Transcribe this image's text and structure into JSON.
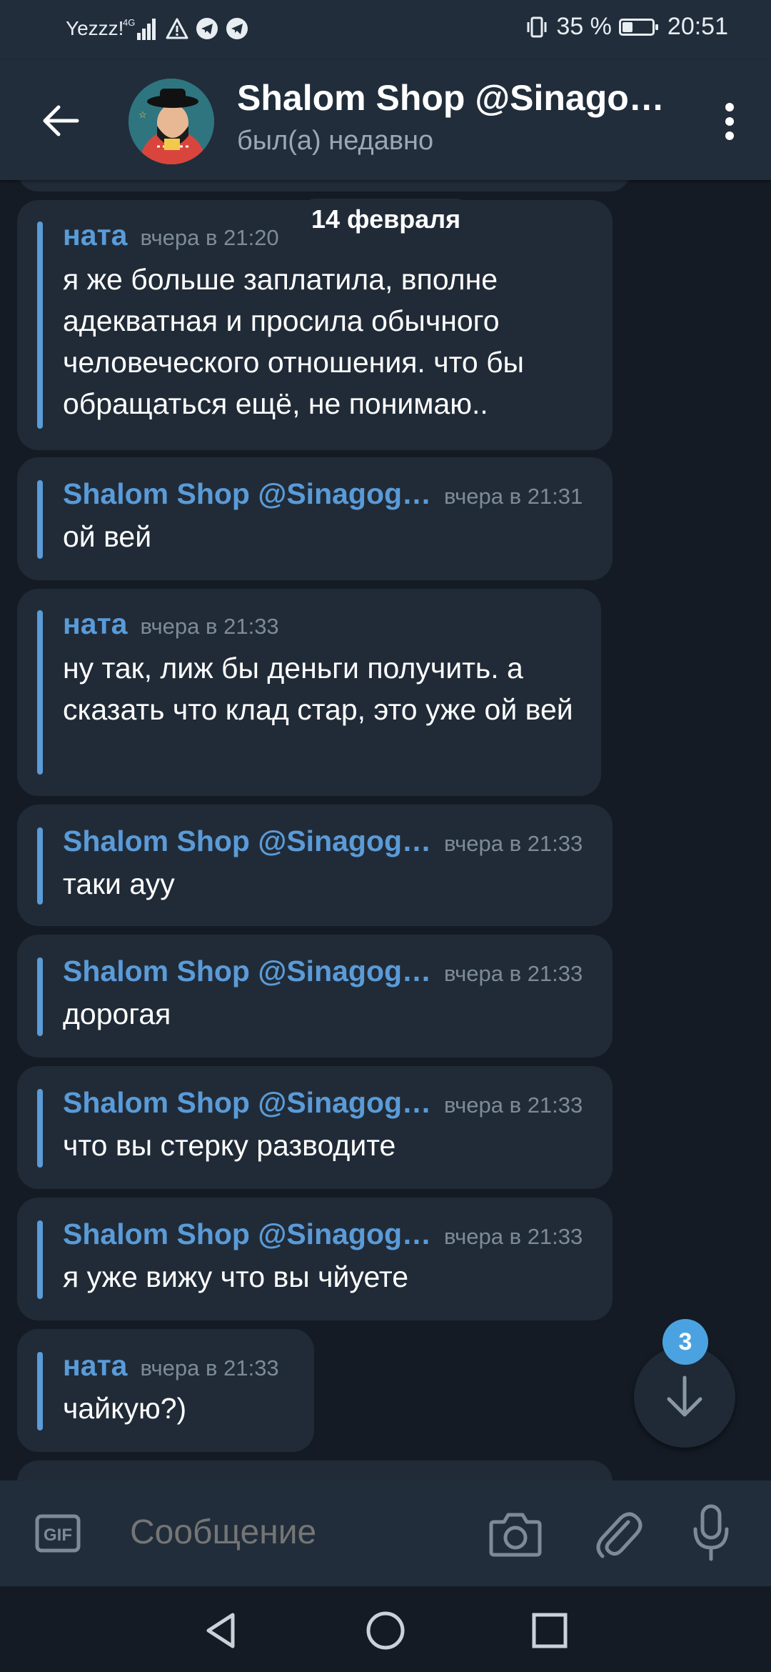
{
  "status_bar": {
    "carrier": "Yezzz!",
    "network": "4G",
    "battery": "35 %",
    "battery_level": 0.35,
    "time": "20:51"
  },
  "header": {
    "title": "Shalom Shop @Sinago…",
    "subtitle": "был(а) недавно"
  },
  "date_divider": "14 февраля",
  "messages": [
    {
      "name": "ната",
      "time": "вчера в 21:20",
      "text": "я же больше заплатила, вполне адекватная и просила обычного человеческого отношения. что бы обращаться ещё, не понимаю.."
    },
    {
      "name": "Shalom Shop @Sinagog…",
      "time": "вчера в 21:31",
      "text": "ой вей"
    },
    {
      "name": "ната",
      "time": "вчера в 21:33",
      "text": "ну так, лиж бы деньги получить. а сказать что клад стар, это уже ой вей"
    },
    {
      "name": "Shalom Shop @Sinagog…",
      "time": "вчера в 21:33",
      "text": "таки ауу"
    },
    {
      "name": "Shalom Shop @Sinagog…",
      "time": "вчера в 21:33",
      "text": "дорогая"
    },
    {
      "name": "Shalom Shop @Sinagog…",
      "time": "вчера в 21:33",
      "text": "что вы стерку разводите"
    },
    {
      "name": "Shalom Shop @Sinagog…",
      "time": "вчера в 21:33",
      "text": "я уже вижу что вы чйуете"
    },
    {
      "name": "ната",
      "time": "вчера в 21:33",
      "text": "чайкую?)"
    }
  ],
  "scroll_down": {
    "unread_count": "3"
  },
  "composer": {
    "placeholder": "Сообщение"
  },
  "colors": {
    "accent": "#5a9bd8",
    "bubble": "#212b37",
    "background": "#141b24",
    "header": "#212d3b",
    "badge": "#4aa3e0"
  },
  "icons": [
    "back-arrow-icon",
    "more-vert-icon",
    "gif-icon",
    "camera-icon",
    "paperclip-icon",
    "microphone-icon",
    "arrow-down-icon",
    "nav-back-icon",
    "nav-home-icon",
    "nav-recents-icon"
  ]
}
